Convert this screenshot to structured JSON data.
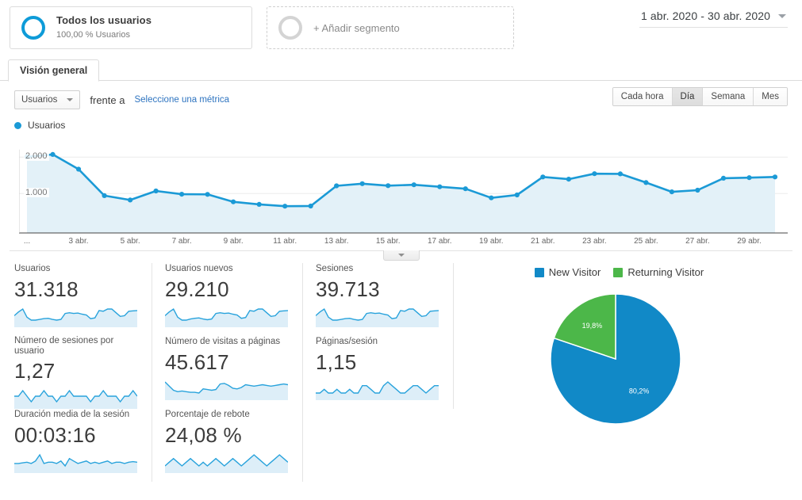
{
  "segments": {
    "all_users": {
      "title": "Todos los usuarios",
      "subtitle": "100,00 % Usuarios",
      "icon": "ring-icon"
    },
    "add_segment": {
      "label": "+ Añadir segmento",
      "icon": "ring-icon"
    }
  },
  "date_range": {
    "label": "1 abr. 2020 - 30 abr. 2020",
    "icon": "chevron-down-icon"
  },
  "tabs": [
    {
      "label": "Visión general",
      "active": true
    }
  ],
  "metric_selector": {
    "selected": "Usuarios",
    "versus_label": "frente a",
    "secondary_link": "Seleccione una métrica",
    "caret_icon": "caret-down-icon"
  },
  "granularity": {
    "options": [
      "Cada hora",
      "Día",
      "Semana",
      "Mes"
    ],
    "selected": "Día"
  },
  "chart_legend": {
    "label": "Usuarios",
    "color": "#1b9ad6"
  },
  "collapse_control": {
    "icon": "chevron-down-icon"
  },
  "chart_data": {
    "type": "line",
    "title": "Usuarios",
    "xlabel": "",
    "ylabel": "Usuarios",
    "ylim": [
      0,
      2400
    ],
    "grid": true,
    "y_ticks": [
      "1.000",
      "2.000"
    ],
    "y_tick_values": [
      1000,
      2000
    ],
    "x_tick_labels": [
      "...",
      "3 abr.",
      "5 abr.",
      "7 abr.",
      "9 abr.",
      "11 abr.",
      "13 abr.",
      "15 abr.",
      "17 abr.",
      "19 abr.",
      "21 abr.",
      "23 abr.",
      "25 abr.",
      "27 abr.",
      "29 abr."
    ],
    "series": [
      {
        "name": "Usuarios",
        "color": "#1b9ad6",
        "x": [
          "1 abr.",
          "2 abr.",
          "3 abr.",
          "4 abr.",
          "5 abr.",
          "6 abr.",
          "7 abr.",
          "8 abr.",
          "9 abr.",
          "10 abr.",
          "11 abr.",
          "12 abr.",
          "13 abr.",
          "14 abr.",
          "15 abr.",
          "16 abr.",
          "17 abr.",
          "18 abr.",
          "19 abr.",
          "20 abr.",
          "21 abr.",
          "22 abr.",
          "23 abr.",
          "24 abr.",
          "25 abr.",
          "26 abr.",
          "27 abr.",
          "28 abr.",
          "29 abr.",
          "30 abr."
        ],
        "values": [
          2010,
          2075,
          1670,
          940,
          820,
          1070,
          980,
          975,
          770,
          700,
          650,
          655,
          1210,
          1270,
          1215,
          1240,
          1185,
          1130,
          880,
          960,
          1455,
          1395,
          1545,
          1540,
          1300,
          1045,
          1090,
          1420,
          1435,
          1455
        ]
      }
    ]
  },
  "metrics": [
    {
      "label": "Usuarios",
      "value": "31.318",
      "spark": [
        52,
        62,
        70,
        48,
        40,
        40,
        42,
        44,
        45,
        42,
        40,
        42,
        58,
        60,
        58,
        59,
        56,
        54,
        44,
        46,
        66,
        64,
        70,
        70,
        60,
        50,
        52,
        64,
        65,
        66
      ]
    },
    {
      "label": "Usuarios nuevos",
      "value": "29.210",
      "spark": [
        50,
        60,
        68,
        46,
        38,
        38,
        41,
        43,
        44,
        41,
        39,
        41,
        56,
        58,
        56,
        57,
        54,
        52,
        43,
        45,
        64,
        62,
        68,
        68,
        58,
        48,
        50,
        62,
        63,
        64
      ]
    },
    {
      "label": "Sesiones",
      "value": "39.713",
      "spark": [
        53,
        63,
        71,
        49,
        41,
        41,
        43,
        45,
        46,
        43,
        41,
        43,
        59,
        61,
        59,
        60,
        57,
        55,
        45,
        47,
        67,
        65,
        71,
        71,
        61,
        51,
        53,
        65,
        66,
        67
      ]
    },
    {
      "label": "Número de sesiones por usuario",
      "value": "1,27",
      "two_line": true,
      "spark": [
        60,
        60,
        61,
        60,
        59,
        60,
        60,
        61,
        60,
        60,
        59,
        60,
        60,
        61,
        60,
        60,
        60,
        60,
        59,
        60,
        60,
        61,
        60,
        60,
        60,
        59,
        60,
        60,
        61,
        60
      ]
    },
    {
      "label": "Número de visitas a páginas",
      "value": "45.617",
      "spark": [
        68,
        56,
        44,
        40,
        42,
        40,
        38,
        38,
        36,
        48,
        46,
        44,
        46,
        62,
        64,
        58,
        50,
        48,
        52,
        60,
        58,
        56,
        58,
        60,
        58,
        56,
        58,
        60,
        62,
        60
      ]
    },
    {
      "label": "Páginas/sesión",
      "value": "1,15",
      "spark": [
        58,
        58,
        59,
        58,
        58,
        59,
        58,
        58,
        59,
        58,
        58,
        60,
        60,
        59,
        58,
        58,
        60,
        61,
        60,
        59,
        58,
        58,
        59,
        60,
        60,
        59,
        58,
        59,
        60,
        60
      ]
    },
    {
      "label": "Duración media de la sesión",
      "value": "00:03:16",
      "spark": [
        58,
        58,
        59,
        60,
        58,
        62,
        72,
        58,
        60,
        60,
        58,
        62,
        54,
        66,
        62,
        58,
        60,
        62,
        58,
        60,
        58,
        60,
        62,
        58,
        60,
        60,
        58,
        60,
        61,
        60
      ]
    },
    {
      "label": "Porcentaje de rebote",
      "value": "24,08 %",
      "spark": [
        58,
        60,
        62,
        60,
        58,
        60,
        62,
        60,
        58,
        60,
        58,
        60,
        62,
        60,
        58,
        60,
        62,
        60,
        58,
        60,
        62,
        64,
        62,
        60,
        58,
        60,
        62,
        64,
        62,
        60
      ]
    }
  ],
  "pie": {
    "chart_data": {
      "type": "pie",
      "title": "",
      "legend_position": "top",
      "labels": [
        "New Visitor",
        "Returning Visitor"
      ],
      "values": [
        80.2,
        19.8
      ],
      "value_labels": [
        "80,2%",
        "19,8%"
      ],
      "colors": [
        "#1189c7",
        "#4cb749"
      ]
    }
  }
}
